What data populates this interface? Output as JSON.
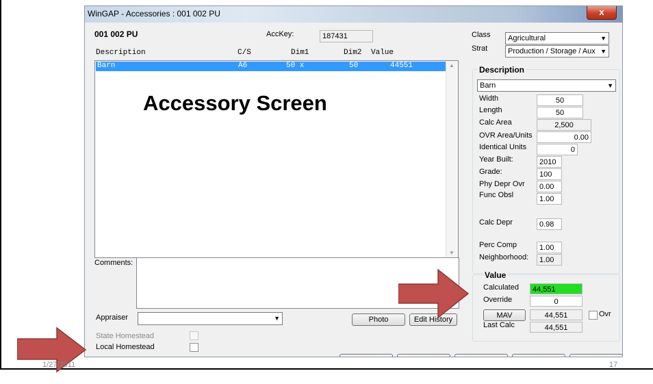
{
  "window": {
    "title": "WinGAP - Accessories : 001   002 PU",
    "close_label": "x"
  },
  "header": {
    "parcel": "001   002 PU",
    "acckey_label": "AccKey:",
    "acckey_value": "187431"
  },
  "classification": {
    "class_label": "Class",
    "class_value": "Agricultural",
    "strat_label": "Strat",
    "strat_value": "Production / Storage / Aux"
  },
  "list": {
    "columns": [
      "Description",
      "C/S",
      "Dim1",
      "Dim2",
      "Value"
    ],
    "rows": [
      {
        "description": "Barn",
        "cs": "A6",
        "dim1": "50 x",
        "dim2": "50",
        "value": "44551"
      }
    ]
  },
  "overlay_title": "Accessory Screen",
  "comments_label": "Comments:",
  "appraiser_label": "Appraiser",
  "appraiser_value": "",
  "buttons": {
    "photo": "Photo",
    "edit_history": "Edit History",
    "mav": "MAV"
  },
  "homestead": {
    "state": "State Homestead",
    "local": "Local Homestead"
  },
  "description_panel": {
    "heading": "Description",
    "type_value": "Barn",
    "fields": {
      "width_label": "Width",
      "width": "50",
      "length_label": "Length",
      "length": "50",
      "calc_area_label": "Calc Area",
      "calc_area": "2,500",
      "ovr_area_label": "OVR Area/Units",
      "ovr_area": "0.00",
      "identical_units_label": "Identical Units",
      "identical_units": "0",
      "year_built_label": "Year Built:",
      "year_built": "2010",
      "grade_label": "Grade:",
      "grade": "100",
      "phy_depr_label": "Phy Depr Ovr",
      "phy_depr": "0.00",
      "func_obsl_label": "Func Obsl",
      "func_obsl": "1.00",
      "calc_depr_label": "Calc Depr",
      "calc_depr": "0.98",
      "perc_comp_label": "Perc Comp",
      "perc_comp": "1.00",
      "neighborhood_label": "Neighborhood:",
      "neighborhood": "1.00"
    }
  },
  "value_panel": {
    "heading": "Value",
    "calculated_label": "Calculated",
    "calculated": "44,551",
    "override_label": "Override",
    "override": "0",
    "mav_value": "44,551",
    "ovr_label": "Ovr",
    "last_calc_label": "Last Calc",
    "last_calc": "44,551"
  },
  "slide": {
    "date": "1/27/2011",
    "page": "17"
  },
  "colors": {
    "selection": "#3399ff",
    "calculated_highlight": "#22dd22",
    "arrow": "#c0504d"
  }
}
